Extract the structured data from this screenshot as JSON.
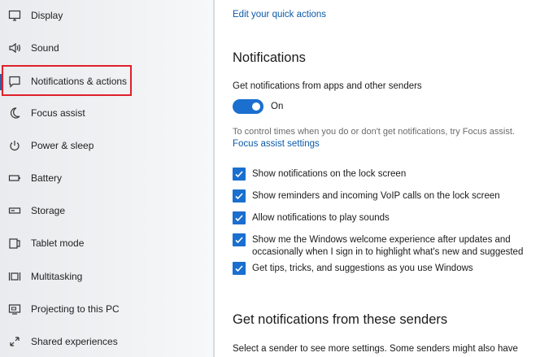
{
  "sidebar": {
    "items": [
      {
        "label": "Display",
        "icon": "monitor-icon"
      },
      {
        "label": "Sound",
        "icon": "speaker-icon"
      },
      {
        "label": "Notifications & actions",
        "icon": "message-icon"
      },
      {
        "label": "Focus assist",
        "icon": "moon-icon"
      },
      {
        "label": "Power & sleep",
        "icon": "power-icon"
      },
      {
        "label": "Battery",
        "icon": "battery-icon"
      },
      {
        "label": "Storage",
        "icon": "storage-icon"
      },
      {
        "label": "Tablet mode",
        "icon": "tablet-icon"
      },
      {
        "label": "Multitasking",
        "icon": "multitasking-icon"
      },
      {
        "label": "Projecting to this PC",
        "icon": "projecting-icon"
      },
      {
        "label": "Shared experiences",
        "icon": "shared-icon"
      }
    ],
    "selected_index": 2,
    "highlight_color": "#e0202a"
  },
  "main": {
    "quick_actions_link": "Edit your quick actions",
    "notifications_heading": "Notifications",
    "get_notifications_label": "Get notifications from apps and other senders",
    "toggle_state": "On",
    "focus_note": "To control times when you do or don't get notifications, try Focus assist.",
    "focus_link": "Focus assist settings",
    "checkboxes": [
      {
        "label": "Show notifications on the lock screen",
        "checked": true
      },
      {
        "label": "Show reminders and incoming VoIP calls on the lock screen",
        "checked": true
      },
      {
        "label": "Allow notifications to play sounds",
        "checked": true
      },
      {
        "label_line1": "Show me the Windows welcome experience after updates and",
        "label_line2": "occasionally when I sign in to highlight what's new and suggested",
        "checked": true
      },
      {
        "label": "Get tips, tricks, and suggestions as you use Windows",
        "checked": true
      }
    ],
    "senders_heading": "Get notifications from these senders",
    "senders_text": "Select a sender to see more settings. Some senders might also have"
  },
  "colors": {
    "accent": "#1a6fcf",
    "link": "#0b5aa8"
  }
}
